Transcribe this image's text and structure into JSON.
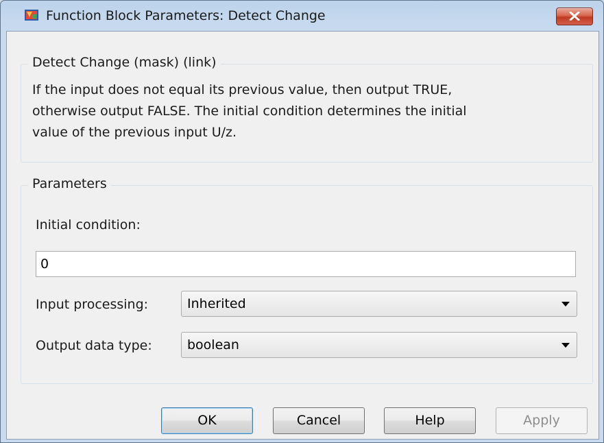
{
  "window": {
    "title": "Function Block Parameters: Detect Change"
  },
  "description_group": {
    "title": "Detect Change (mask) (link)",
    "lines": [
      "If the input does not equal its previous value, then output TRUE,",
      "otherwise output FALSE.  The initial condition determines the initial",
      "value of the previous input U/z."
    ]
  },
  "parameters_group": {
    "title": "Parameters",
    "initial_condition": {
      "label": "Initial condition:",
      "value": "0"
    },
    "input_processing": {
      "label": "Input processing:",
      "value": "Inherited"
    },
    "output_data_type": {
      "label": "Output data type:",
      "value": "boolean"
    }
  },
  "buttons": {
    "ok": "OK",
    "cancel": "Cancel",
    "help": "Help",
    "apply": "Apply"
  },
  "colors": {
    "frame": "#c9daee",
    "client_bg": "#f0f0f0",
    "close_button": "#c13a22",
    "default_button_border": "#3c7fb1"
  },
  "icons": {
    "app": "simulink-block-icon",
    "close": "close-icon",
    "dropdown": "chevron-down-icon"
  }
}
